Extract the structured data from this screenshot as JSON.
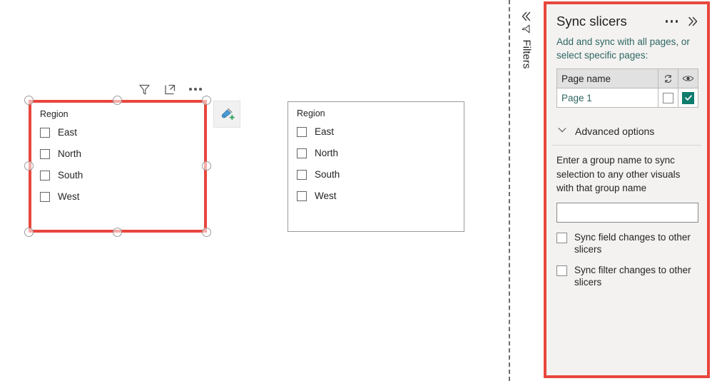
{
  "canvas": {
    "slicers": [
      {
        "id": "selected",
        "title": "Region",
        "items": [
          "East",
          "North",
          "South",
          "West"
        ],
        "selected": true,
        "selection_color": "#e8463d"
      },
      {
        "id": "plain",
        "title": "Region",
        "items": [
          "East",
          "North",
          "South",
          "West"
        ],
        "selected": false,
        "border_color": "#9a9a9a"
      }
    ],
    "visual_toolbar": [
      {
        "name": "filter-icon",
        "tooltip": "Filters"
      },
      {
        "name": "focus-mode-icon",
        "tooltip": "Focus mode"
      },
      {
        "name": "more-options-icon",
        "tooltip": "More options"
      }
    ],
    "format_painter": {
      "name": "format-painter-icon",
      "tooltip": "Format painter"
    }
  },
  "filters_rail": {
    "collapse_icon": "chevron-double-left-icon",
    "filter_icon": "funnel-icon",
    "label": "Filters"
  },
  "sync_panel": {
    "title": "Sync slicers",
    "ellipsis_icon": "more-options-icon",
    "collapse_icon": "chevron-double-right-icon",
    "description": "Add and sync with all pages, or select specific pages:",
    "table": {
      "headers": {
        "page_name": "Page name",
        "sync_icon": "sync-icon",
        "visible_icon": "eye-icon"
      },
      "rows": [
        {
          "page_name": "Page 1",
          "sync": false,
          "visible": true
        }
      ]
    },
    "advanced": {
      "label": "Advanced options",
      "chevron_icon": "chevron-down-icon",
      "description": "Enter a group name to sync selection to any other visuals with that group name",
      "group_name_value": "",
      "group_name_placeholder": "",
      "checkboxes": [
        {
          "label": "Sync field changes to other slicers",
          "checked": false
        },
        {
          "label": "Sync filter changes to other slicers",
          "checked": false
        }
      ]
    },
    "accent_color": "#0f7b6c",
    "highlight_color": "#e8473e",
    "background_color": "#f3f2f1"
  }
}
